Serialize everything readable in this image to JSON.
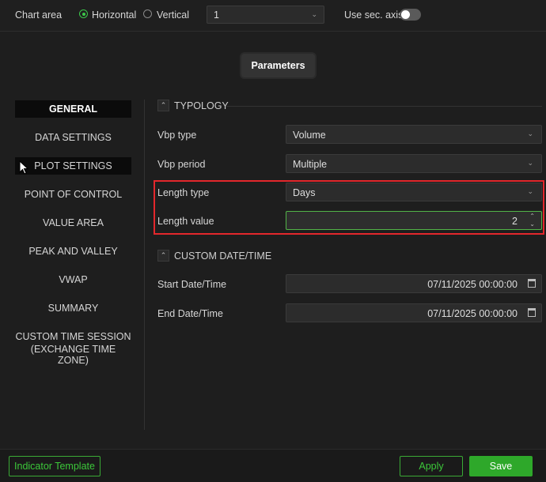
{
  "toolbar": {
    "chart_area_label": "Chart area",
    "orientation_options": [
      "Horizontal",
      "Vertical"
    ],
    "orientation_selected": "Horizontal",
    "chart_area_value": "1",
    "sec_axis_label": "Use sec. axis",
    "sec_axis_on": false
  },
  "parameters_button": "Parameters",
  "nav": {
    "items": [
      "GENERAL",
      "DATA SETTINGS",
      "PLOT SETTINGS",
      "POINT OF CONTROL",
      "VALUE AREA",
      "PEAK AND VALLEY",
      "VWAP",
      "SUMMARY",
      "CUSTOM TIME SESSION",
      "(EXCHANGE TIME ZONE)"
    ],
    "active": "GENERAL"
  },
  "typology": {
    "title": "TYPOLOGY",
    "rows": [
      {
        "label": "Vbp type",
        "value": "Volume"
      },
      {
        "label": "Vbp period",
        "value": "Multiple"
      },
      {
        "label": "Length type",
        "value": "Days"
      },
      {
        "label": "Length value",
        "value": "2"
      }
    ]
  },
  "custom_date": {
    "title": "CUSTOM DATE/TIME",
    "rows": [
      {
        "label": "Start Date/Time",
        "value": "07/11/2025 00:00:00"
      },
      {
        "label": "End Date/Time",
        "value": "07/11/2025 00:00:00"
      }
    ]
  },
  "footer": {
    "template_label": "Indicator Template",
    "apply_label": "Apply",
    "save_label": "Save"
  },
  "colors": {
    "accent": "#2ea82a",
    "highlight": "#e3272c",
    "background": "#1e1e1e"
  }
}
